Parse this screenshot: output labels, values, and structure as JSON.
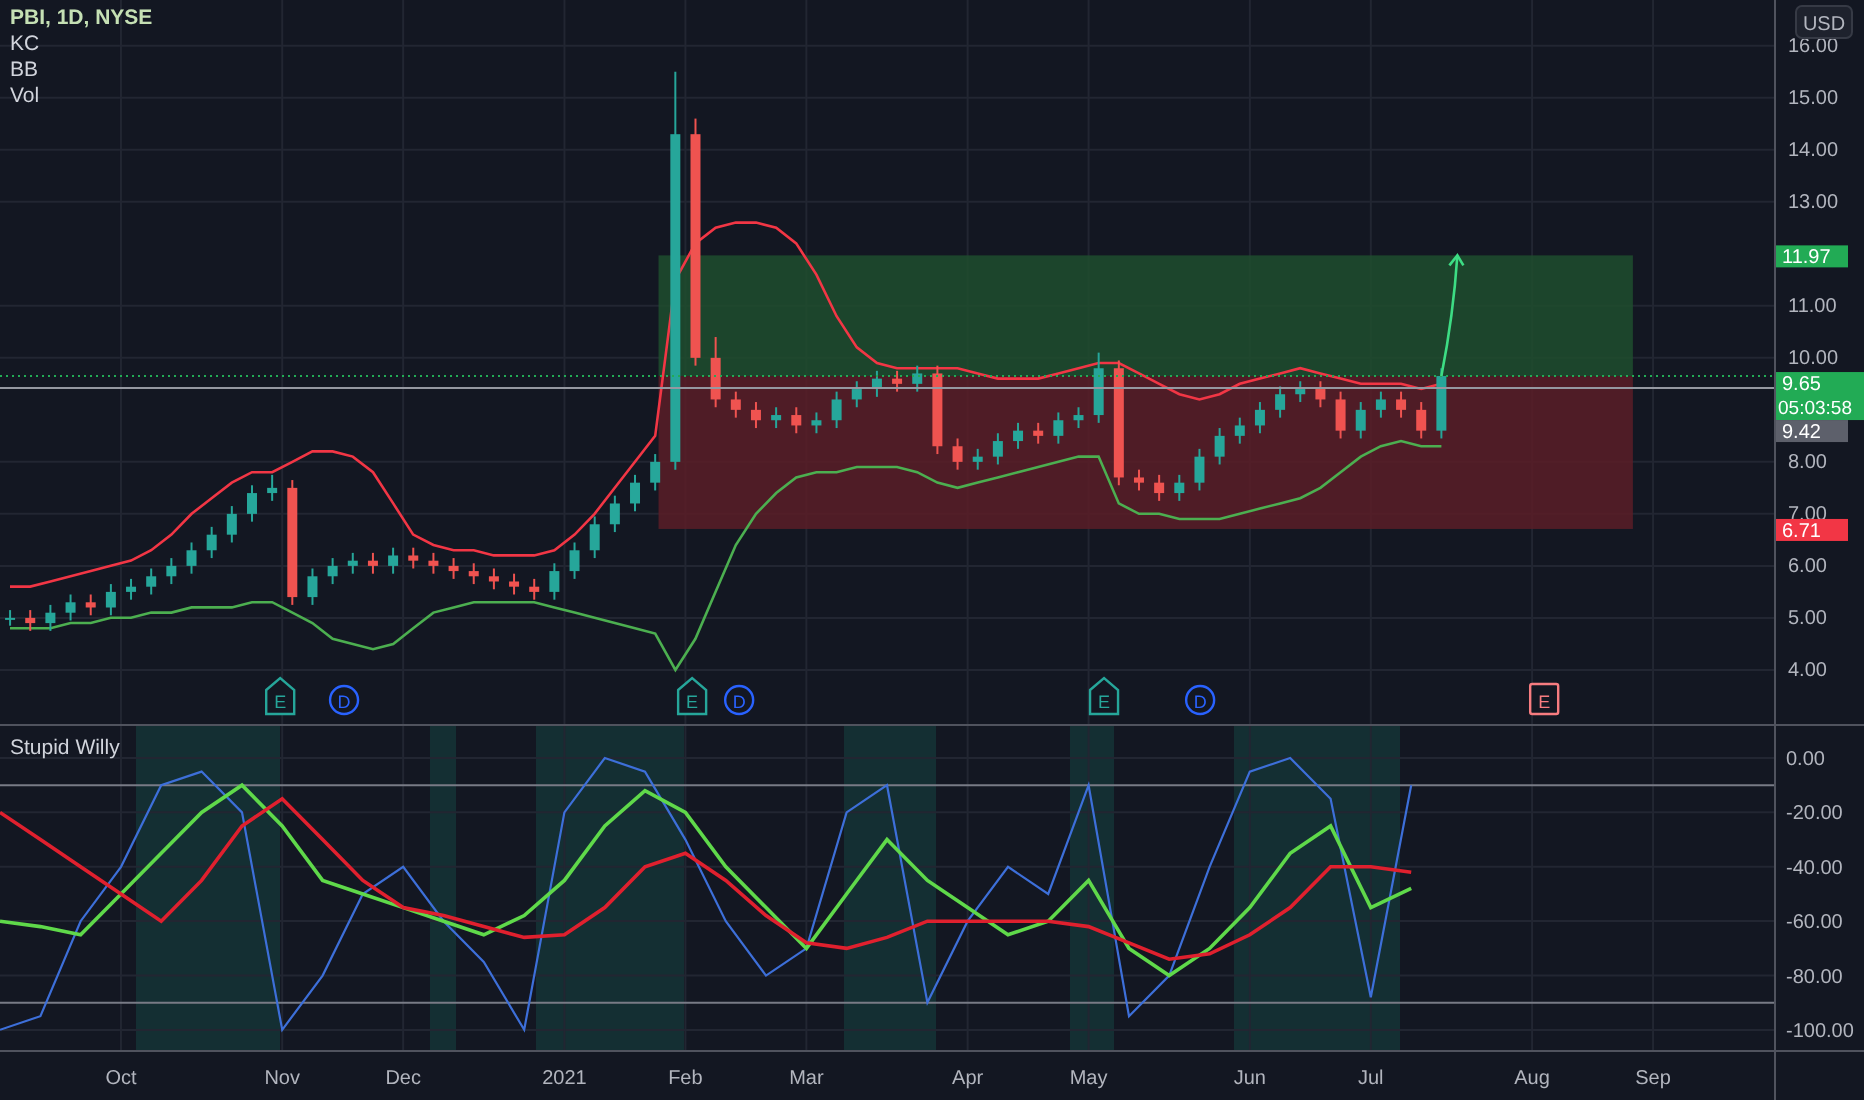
{
  "legend": {
    "symbol": "PBI, 1D, NYSE",
    "indicators": [
      "KC",
      "BB",
      "Vol"
    ]
  },
  "price_axis": {
    "currency": "USD"
  },
  "price_labels": [
    {
      "kind": "target",
      "text": "11.97"
    },
    {
      "kind": "last",
      "text": "9.65",
      "countdown": "05:03:58"
    },
    {
      "kind": "line",
      "text": "9.42"
    },
    {
      "kind": "stop",
      "text": "6.71"
    }
  ],
  "events": [
    {
      "kind": "earnings",
      "label": "E"
    },
    {
      "kind": "dividend",
      "label": "D"
    },
    {
      "kind": "earnings",
      "label": "E"
    },
    {
      "kind": "dividend",
      "label": "D"
    },
    {
      "kind": "earnings",
      "label": "E"
    },
    {
      "kind": "dividend",
      "label": "D"
    },
    {
      "kind": "earnings_upcoming",
      "label": "E"
    }
  ],
  "price_chart": {
    "chart_data": {
      "type": "candlestick",
      "ylim": [
        2.96,
        16.88
      ],
      "ref_lines": [
        {
          "axis": "y",
          "value": 9.42,
          "color": "#9598a1"
        },
        {
          "axis": "y",
          "value": 9.65,
          "color": "#22ab55"
        }
      ],
      "grid": true,
      "categories": [
        null,
        null,
        null,
        null,
        null,
        null,
        null,
        null,
        null,
        null,
        null,
        null,
        null,
        null,
        null,
        null,
        null,
        null,
        null,
        null,
        null,
        null,
        null,
        null,
        null,
        null,
        null,
        null,
        null,
        null,
        null,
        null,
        null,
        null,
        null,
        null,
        null,
        null,
        null,
        null,
        null,
        null,
        null,
        null,
        null,
        null,
        null,
        null,
        null,
        null,
        null,
        null,
        null,
        null,
        null,
        null,
        null,
        null,
        null,
        null,
        null,
        null,
        null,
        null,
        null,
        null,
        null,
        null,
        null,
        null,
        null,
        null,
        null,
        null,
        null,
        null,
        null,
        null,
        null,
        null,
        null,
        null,
        null,
        null,
        null,
        null,
        null,
        null
      ],
      "ohlc": [
        [
          5.0,
          5.15,
          4.85,
          5.0
        ],
        [
          5.0,
          5.15,
          4.75,
          4.9
        ],
        [
          4.9,
          5.25,
          4.75,
          5.1
        ],
        [
          5.1,
          5.45,
          4.95,
          5.3
        ],
        [
          5.3,
          5.45,
          5.05,
          5.2
        ],
        [
          5.2,
          5.65,
          5.05,
          5.5
        ],
        [
          5.5,
          5.75,
          5.35,
          5.6
        ],
        [
          5.6,
          5.95,
          5.45,
          5.8
        ],
        [
          5.8,
          6.15,
          5.65,
          6.0
        ],
        [
          6.0,
          6.45,
          5.85,
          6.3
        ],
        [
          6.3,
          6.75,
          6.15,
          6.6
        ],
        [
          6.6,
          7.15,
          6.45,
          7.0
        ],
        [
          7.0,
          7.55,
          6.85,
          7.4
        ],
        [
          7.4,
          7.75,
          7.25,
          7.5
        ],
        [
          7.5,
          7.65,
          5.25,
          5.4
        ],
        [
          5.4,
          5.95,
          5.25,
          5.8
        ],
        [
          5.8,
          6.15,
          5.65,
          6.0
        ],
        [
          6.0,
          6.25,
          5.85,
          6.1
        ],
        [
          6.1,
          6.25,
          5.85,
          6.0
        ],
        [
          6.0,
          6.35,
          5.85,
          6.2
        ],
        [
          6.2,
          6.35,
          5.95,
          6.1
        ],
        [
          6.1,
          6.25,
          5.85,
          6.0
        ],
        [
          6.0,
          6.15,
          5.75,
          5.9
        ],
        [
          5.9,
          6.05,
          5.65,
          5.8
        ],
        [
          5.8,
          5.95,
          5.55,
          5.7
        ],
        [
          5.7,
          5.85,
          5.45,
          5.6
        ],
        [
          5.6,
          5.75,
          5.35,
          5.5
        ],
        [
          5.5,
          6.05,
          5.35,
          5.9
        ],
        [
          5.9,
          6.45,
          5.75,
          6.3
        ],
        [
          6.3,
          6.95,
          6.15,
          6.8
        ],
        [
          6.8,
          7.35,
          6.65,
          7.2
        ],
        [
          7.2,
          7.75,
          7.05,
          7.6
        ],
        [
          7.6,
          8.15,
          7.45,
          8.0
        ],
        [
          8.0,
          15.5,
          7.85,
          14.3
        ],
        [
          14.3,
          14.6,
          9.85,
          10.0
        ],
        [
          10.0,
          10.4,
          9.05,
          9.2
        ],
        [
          9.2,
          9.35,
          8.85,
          9.0
        ],
        [
          9.0,
          9.15,
          8.65,
          8.8
        ],
        [
          8.8,
          9.05,
          8.65,
          8.9
        ],
        [
          8.9,
          9.05,
          8.55,
          8.7
        ],
        [
          8.7,
          8.95,
          8.55,
          8.8
        ],
        [
          8.8,
          9.35,
          8.65,
          9.2
        ],
        [
          9.2,
          9.55,
          9.05,
          9.4
        ],
        [
          9.4,
          9.75,
          9.25,
          9.6
        ],
        [
          9.6,
          9.75,
          9.35,
          9.5
        ],
        [
          9.5,
          9.85,
          9.35,
          9.7
        ],
        [
          9.7,
          9.85,
          8.15,
          8.3
        ],
        [
          8.3,
          8.45,
          7.85,
          8.0
        ],
        [
          8.0,
          8.25,
          7.85,
          8.1
        ],
        [
          8.1,
          8.55,
          7.95,
          8.4
        ],
        [
          8.4,
          8.75,
          8.25,
          8.6
        ],
        [
          8.6,
          8.75,
          8.35,
          8.5
        ],
        [
          8.5,
          8.95,
          8.35,
          8.8
        ],
        [
          8.8,
          9.05,
          8.65,
          8.9
        ],
        [
          8.9,
          10.1,
          8.75,
          9.8
        ],
        [
          9.8,
          9.95,
          7.55,
          7.7
        ],
        [
          7.7,
          7.85,
          7.45,
          7.6
        ],
        [
          7.6,
          7.75,
          7.25,
          7.4
        ],
        [
          7.4,
          7.75,
          7.25,
          7.6
        ],
        [
          7.6,
          8.25,
          7.45,
          8.1
        ],
        [
          8.1,
          8.65,
          7.95,
          8.5
        ],
        [
          8.5,
          8.85,
          8.35,
          8.7
        ],
        [
          8.7,
          9.15,
          8.55,
          9.0
        ],
        [
          9.0,
          9.45,
          8.85,
          9.3
        ],
        [
          9.3,
          9.55,
          9.15,
          9.4
        ],
        [
          9.4,
          9.55,
          9.05,
          9.2
        ],
        [
          9.2,
          9.35,
          8.45,
          8.6
        ],
        [
          8.6,
          9.15,
          8.45,
          9.0
        ],
        [
          9.0,
          9.35,
          8.85,
          9.2
        ],
        [
          9.2,
          9.35,
          8.85,
          9.0
        ],
        [
          9.0,
          9.15,
          8.45,
          8.6
        ],
        [
          8.6,
          9.8,
          8.45,
          9.65
        ],
        null,
        null,
        null,
        null,
        null,
        null,
        null,
        null,
        null,
        null,
        null,
        null,
        null,
        null,
        null,
        null
      ],
      "series": [
        {
          "type": "line",
          "color": "#f23645",
          "values": [
            5.6,
            5.6,
            5.7,
            5.8,
            5.9,
            6.0,
            6.1,
            6.3,
            6.6,
            7.0,
            7.3,
            7.6,
            7.8,
            7.8,
            8.0,
            8.2,
            8.2,
            8.1,
            7.8,
            7.2,
            6.6,
            6.4,
            6.3,
            6.3,
            6.2,
            6.2,
            6.2,
            6.3,
            6.6,
            7.0,
            7.5,
            8.0,
            8.5,
            11.5,
            12.2,
            12.5,
            12.6,
            12.6,
            12.5,
            12.2,
            11.6,
            10.8,
            10.2,
            9.9,
            9.8,
            9.8,
            9.8,
            9.8,
            9.7,
            9.6,
            9.6,
            9.6,
            9.7,
            9.8,
            9.9,
            9.9,
            9.7,
            9.5,
            9.3,
            9.2,
            9.3,
            9.5,
            9.6,
            9.7,
            9.8,
            9.7,
            9.6,
            9.5,
            9.5,
            9.5,
            9.4,
            9.5,
            null,
            null,
            null,
            null,
            null,
            null,
            null,
            null,
            null,
            null,
            null,
            null,
            null,
            null,
            null,
            null
          ]
        },
        {
          "type": "line",
          "color": "#4caf50",
          "values": [
            4.8,
            4.8,
            4.8,
            4.9,
            4.9,
            5.0,
            5.0,
            5.1,
            5.1,
            5.2,
            5.2,
            5.2,
            5.3,
            5.3,
            5.1,
            4.9,
            4.6,
            4.5,
            4.4,
            4.5,
            4.8,
            5.1,
            5.2,
            5.3,
            5.3,
            5.3,
            5.3,
            5.2,
            5.1,
            5.0,
            4.9,
            4.8,
            4.7,
            4.0,
            4.6,
            5.5,
            6.4,
            7.0,
            7.4,
            7.7,
            7.8,
            7.8,
            7.9,
            7.9,
            7.9,
            7.8,
            7.6,
            7.5,
            7.6,
            7.7,
            7.8,
            7.9,
            8.0,
            8.1,
            8.1,
            7.2,
            7.0,
            7.0,
            6.9,
            6.9,
            6.9,
            7.0,
            7.1,
            7.2,
            7.3,
            7.5,
            7.8,
            8.1,
            8.3,
            8.4,
            8.3,
            8.3,
            null,
            null,
            null,
            null,
            null,
            null,
            null,
            null,
            null,
            null,
            null,
            null,
            null,
            null,
            null,
            null
          ]
        }
      ],
      "yticks": [
        {
          "value": 16,
          "label": "16.00"
        },
        {
          "value": 15,
          "label": "15.00"
        },
        {
          "value": 14,
          "label": "14.00"
        },
        {
          "value": 13,
          "label": "13.00"
        },
        {
          "value": 11,
          "label": "11.00"
        },
        {
          "value": 10,
          "label": "10.00"
        },
        {
          "value": 8,
          "label": "8.00"
        },
        {
          "value": 7,
          "label": "7.00"
        },
        {
          "value": 6,
          "label": "6.00"
        },
        {
          "value": 5,
          "label": "5.00"
        },
        {
          "value": 4,
          "label": "4.00"
        }
      ]
    }
  },
  "indicator": {
    "title": "Stupid Willy",
    "chart_data": {
      "type": "line",
      "grid": true,
      "ylim": [
        -107.4,
        12.5
      ],
      "ref_lines": [
        {
          "axis": "y",
          "value": -10,
          "color": "#787b86"
        },
        {
          "axis": "y",
          "value": -90,
          "color": "#787b86"
        }
      ],
      "categories": [
        null,
        null,
        null,
        "Oct",
        null,
        null,
        null,
        "Nov",
        null,
        null,
        "Dec",
        null,
        null,
        null,
        "2021",
        null,
        null,
        "Feb",
        null,
        null,
        "Mar",
        null,
        null,
        null,
        "Apr",
        null,
        null,
        "May",
        null,
        null,
        null,
        "Jun",
        null,
        null,
        "Jul",
        null,
        null,
        null,
        "Aug",
        null,
        null,
        "Sep",
        null,
        null,
        null
      ],
      "series": [
        {
          "color": "#3d6fd9",
          "values": [
            -100,
            -95,
            -60,
            -40,
            -10,
            -5,
            -20,
            -100,
            -80,
            -50,
            -40,
            -60,
            -75,
            -100,
            -20,
            0,
            -5,
            -30,
            -60,
            -80,
            -70,
            -20,
            -10,
            -90,
            -60,
            -40,
            -50,
            -10,
            -95,
            -80,
            -40,
            -5,
            0,
            -15,
            -88,
            -10,
            null,
            null,
            null,
            null,
            null,
            null,
            null,
            null,
            null
          ]
        },
        {
          "color": "#5fd94a",
          "values": [
            -60,
            -62,
            -65,
            -50,
            -35,
            -20,
            -10,
            -25,
            -45,
            -50,
            -55,
            -60,
            -65,
            -58,
            -45,
            -25,
            -12,
            -20,
            -40,
            -55,
            -70,
            -50,
            -30,
            -45,
            -55,
            -65,
            -60,
            -45,
            -70,
            -80,
            -70,
            -55,
            -35,
            -25,
            -55,
            -48,
            null,
            null,
            null,
            null,
            null,
            null,
            null,
            null,
            null
          ]
        },
        {
          "color": "#e0202e",
          "values": [
            -20,
            -30,
            -40,
            -50,
            -60,
            -45,
            -25,
            -15,
            -30,
            -45,
            -55,
            -58,
            -62,
            -66,
            -65,
            -55,
            -40,
            -35,
            -45,
            -58,
            -68,
            -70,
            -66,
            -60,
            -60,
            -60,
            -60,
            -62,
            -68,
            -74,
            -72,
            -65,
            -55,
            -40,
            -40,
            -42,
            null,
            null,
            null,
            null,
            null,
            null,
            null,
            null,
            null
          ]
        }
      ],
      "yticks": [
        {
          "value": 0,
          "label": "0.00"
        },
        {
          "value": -20,
          "label": "-20.00"
        },
        {
          "value": -40,
          "label": "-40.00"
        },
        {
          "value": -60,
          "label": "-60.00"
        },
        {
          "value": -80,
          "label": "-80.00"
        },
        {
          "value": -100,
          "label": "-100.00"
        }
      ]
    }
  }
}
